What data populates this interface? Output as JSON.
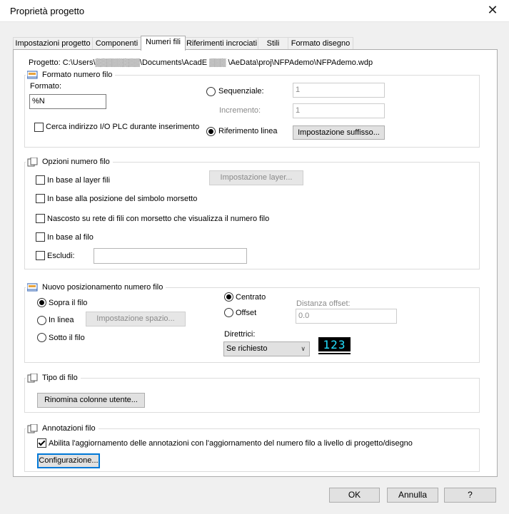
{
  "window": {
    "title": "Proprietà progetto"
  },
  "tabs": [
    {
      "label": "Impostazioni progetto"
    },
    {
      "label": "Componenti"
    },
    {
      "label": "Numeri fili"
    },
    {
      "label": "Riferimenti incrociati"
    },
    {
      "label": "Stili"
    },
    {
      "label": "Formato disegno"
    }
  ],
  "project": {
    "label": "Progetto:",
    "path": "C:\\Users\\▒▒▒▒▒▒▒▒\\Documents\\AcadE ▒▒▒ \\AeData\\proj\\NFPAdemo\\NFPAdemo.wdp"
  },
  "formato": {
    "legend": "Formato numero filo",
    "format_label": "Formato:",
    "format_value": "%N",
    "sequenziale_label": "Sequenziale:",
    "sequenziale_value": "1",
    "incremento_label": "Incremento:",
    "incremento_value": "1",
    "cerca_label": "Cerca indirizzo I/O PLC durante inserimento",
    "riferimento_label": "Riferimento linea",
    "suffisso_button": "Impostazione suffisso..."
  },
  "opzioni": {
    "legend": "Opzioni numero filo",
    "layer_label": "In base al layer fili",
    "layer_button": "Impostazione layer...",
    "morsetto_label": "In base alla posizione del simbolo morsetto",
    "nascosto_label": "Nascosto su rete di fili con morsetto che visualizza il numero filo",
    "filo_label": "In base al filo",
    "escludi_label": "Escludi:",
    "escludi_value": ""
  },
  "posizionamento": {
    "legend": "Nuovo posizionamento numero filo",
    "sopra_label": "Sopra il filo",
    "inlinea_label": "In linea",
    "spazio_button": "Impostazione spazio...",
    "sotto_label": "Sotto il filo",
    "centrato_label": "Centrato",
    "offset_label": "Offset",
    "distanza_label": "Distanza offset:",
    "distanza_value": "0.0",
    "direttrici_label": "Direttrici:",
    "direttrici_value": "Se richiesto",
    "preview_text": "123"
  },
  "tipo": {
    "legend": "Tipo di filo",
    "rinomina_button": "Rinomina colonne utente..."
  },
  "annotazioni": {
    "legend": "Annotazioni filo",
    "abilita_label": "Abilita l'aggiornamento delle annotazioni con l'aggiornamento del numero filo a livello di progetto/disegno",
    "config_button": "Configurazione..."
  },
  "footer": {
    "ok": "OK",
    "annulla": "Annulla",
    "help": "?"
  }
}
